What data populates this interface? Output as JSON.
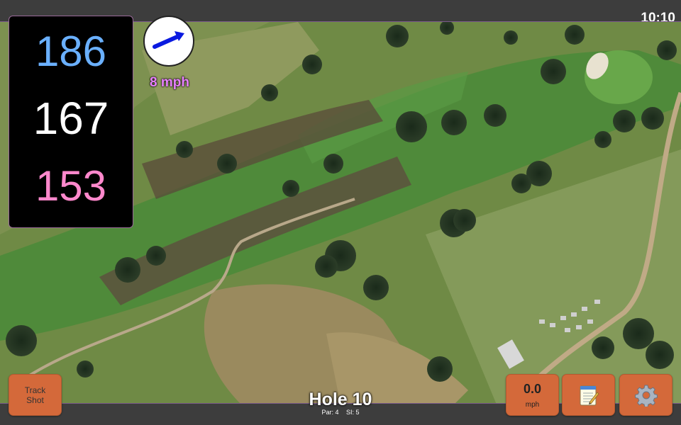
{
  "status_bar": {
    "time": "10:10"
  },
  "distances": {
    "back": "186",
    "middle": "167",
    "front": "153"
  },
  "wind": {
    "speed": "8 mph",
    "direction_icon": "wind-arrow-icon"
  },
  "buttons": {
    "track_shot_line1": "Track",
    "track_shot_line2": "Shot",
    "speed_value": "0.0",
    "speed_unit": "mph",
    "notes_icon": "notepad-icon",
    "settings_icon": "gear-icon"
  },
  "hole": {
    "title": "Hole 10",
    "par": "Par: 4",
    "si": "SI: 5"
  },
  "colors": {
    "back_distance": "#6ab0ff",
    "middle_distance": "#ffffff",
    "front_distance": "#ff88cc",
    "wind_text": "#e880ff",
    "button": "#d4693a"
  }
}
